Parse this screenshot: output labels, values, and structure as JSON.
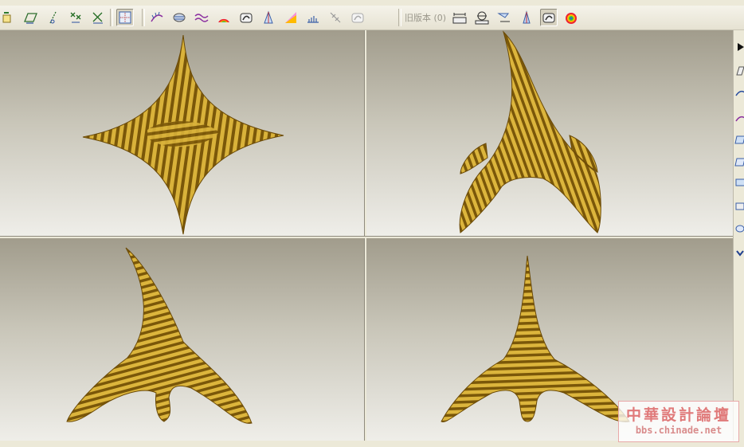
{
  "toolbar": {
    "label_old_version": "旧版本 (0)",
    "group1_icons": [
      "datum-csys-icon",
      "datum-plane-icon",
      "datum-axis-icon",
      "datum-point-icon",
      "datum-csys-tools-icon"
    ],
    "group2_icons": [
      "sketch-grid-icon"
    ],
    "group3_icons": [
      "curvature-analysis-icon",
      "section-analysis-icon",
      "curve-wave-icon",
      "reflection-analysis-icon",
      "shade-analysis-icon",
      "draft-analysis-icon",
      "slope-analysis-icon",
      "dihedral-angle-icon",
      "offset-analysis-icon",
      "deviation-analysis-icon"
    ],
    "group4_icons": [
      "measure-distance-icon",
      "measure-diameter-icon",
      "measure-angle-icon",
      "draft-check-icon",
      "shade-toggle-icon",
      "color-map-icon"
    ],
    "pressed_buttons": [
      "sketch-grid-icon",
      "shade-analysis-icon",
      "shade-toggle-icon"
    ]
  },
  "viewports": [
    {
      "name": "top-view",
      "view": "top"
    },
    {
      "name": "iso-view",
      "view": "isometric"
    },
    {
      "name": "front-view",
      "view": "front"
    },
    {
      "name": "side-view",
      "view": "side"
    }
  ],
  "right_toolbar": {
    "icons": [
      "play-arrow-icon",
      "datum-sketch-icon",
      "curve-arc-icon",
      "boundary-blend-icon",
      "surface-icon",
      "surface-fill-icon",
      "surface-extend-icon",
      "surface-merge-icon",
      "surface-trim-icon",
      "expand-chevron-icon"
    ]
  },
  "colors": {
    "surface_gold": "#d9b23a",
    "surface_dark": "#6e4e08",
    "background_top": "#a19c8c",
    "background_bottom": "#efeee9",
    "toolbar_bg": "#ece9d8",
    "watermark_red": "#e07a7a"
  },
  "watermark": {
    "title": "中華設計論壇",
    "url": "bbs.chinade.net"
  }
}
